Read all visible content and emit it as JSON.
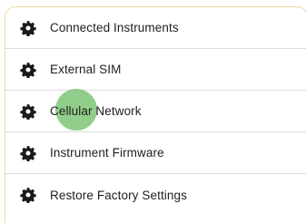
{
  "menu": {
    "items": [
      {
        "label": "Connected Instruments",
        "icon": "gear-icon"
      },
      {
        "label": "External SIM",
        "icon": "gear-icon"
      },
      {
        "label": "Cellular Network",
        "icon": "gear-icon"
      },
      {
        "label": "Instrument Firmware",
        "icon": "gear-icon"
      },
      {
        "label": "Restore Factory Settings",
        "icon": "gear-icon"
      }
    ]
  },
  "colors": {
    "panel_border": "#f0d9a8",
    "divider": "#dcdcdc",
    "text": "#1e1e1e",
    "icon": "#1a1a1a",
    "touch_indicator": "#6ebe64"
  }
}
